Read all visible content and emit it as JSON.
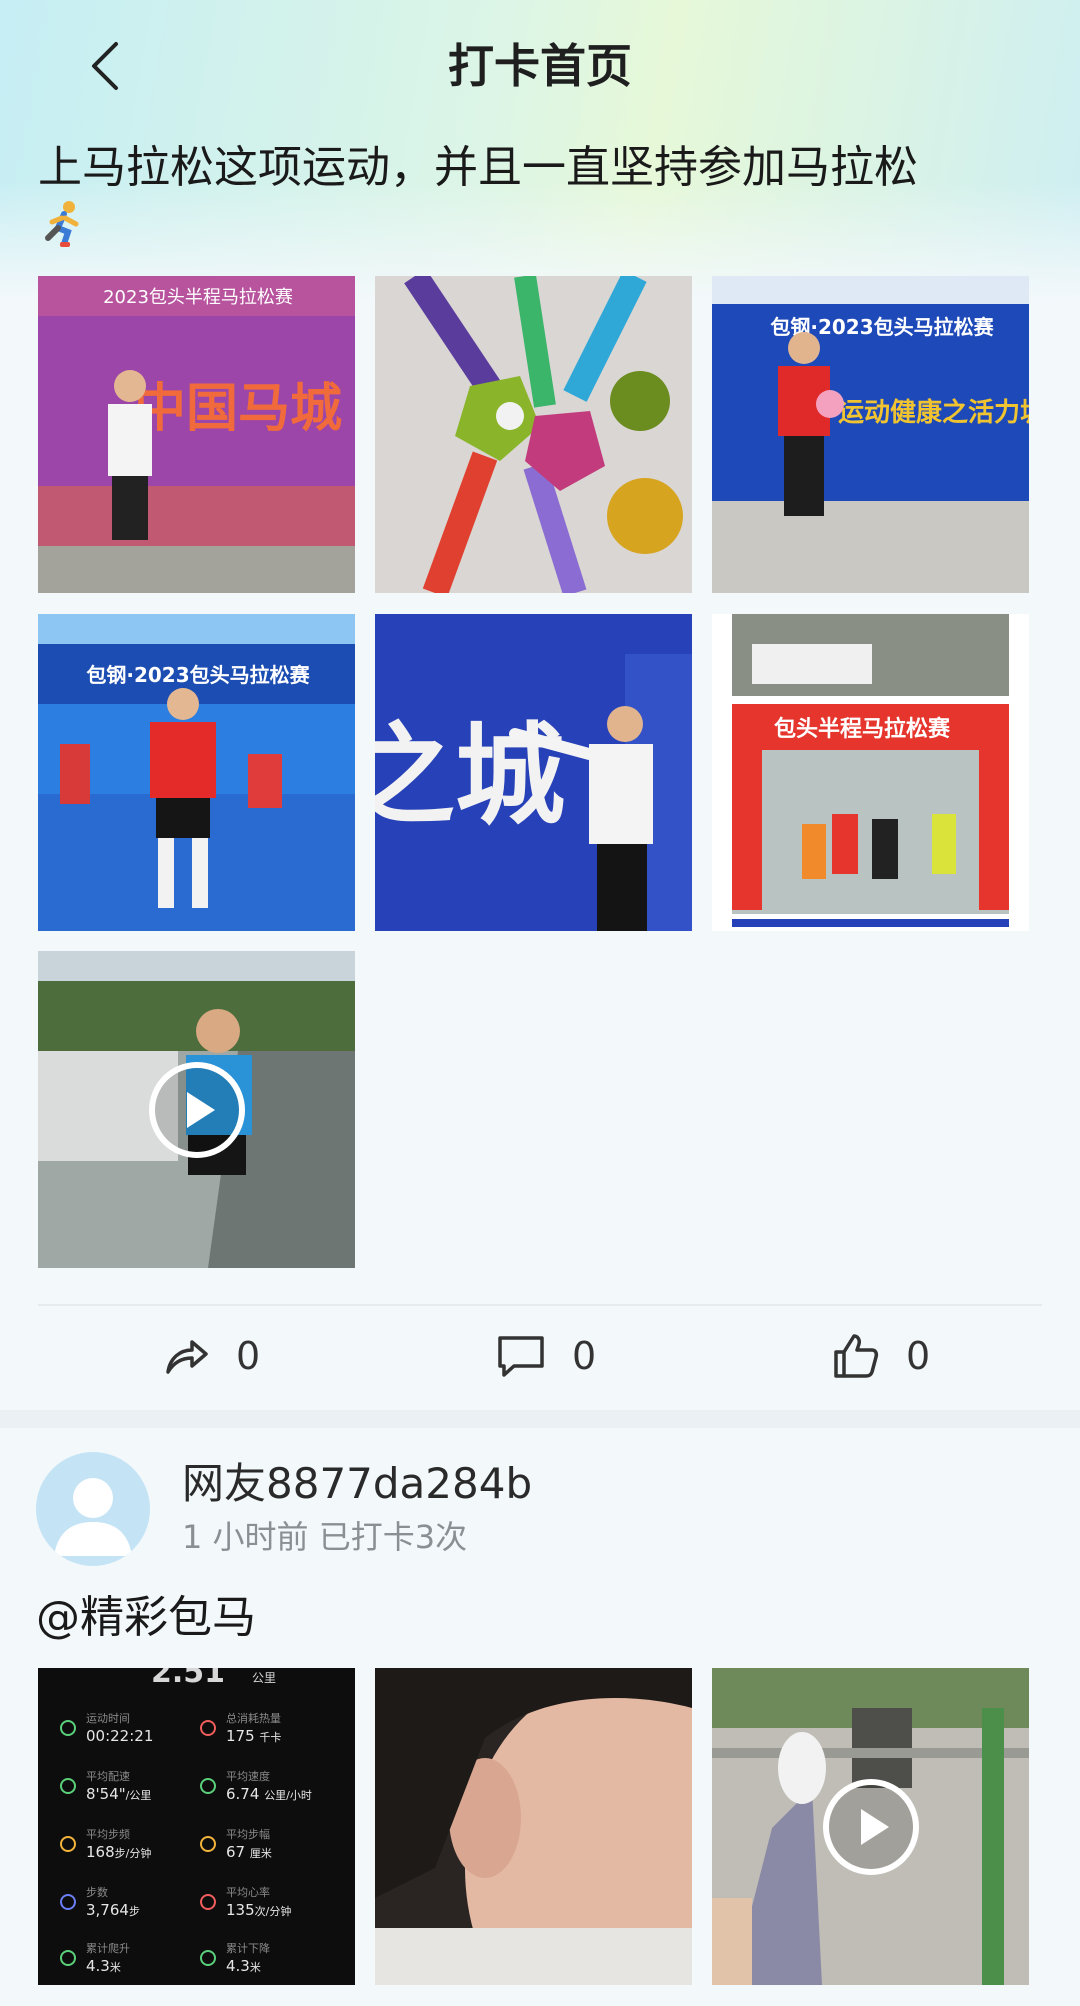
{
  "header": {
    "title": "打卡首页"
  },
  "post1": {
    "text": "上马拉松这项运动，并且一直坚持参加马拉松",
    "emoji_icon": "runner-icon",
    "images": [
      {
        "name": "photo-signature-wall",
        "sign_text": "中国马城",
        "banner_text": "2023包头半程马拉松赛"
      },
      {
        "name": "photo-medals"
      },
      {
        "name": "photo-thumbs-up-banner",
        "banner_text": "包钢·2023包头马拉松赛",
        "slogan": "运动健康之活力城"
      },
      {
        "name": "photo-finish-line",
        "banner_text": "包钢·2023包头马拉松赛"
      },
      {
        "name": "photo-signing-wall",
        "sign_text": "之城"
      },
      {
        "name": "photo-runners-arch",
        "banner_text": "包头半程马拉松赛"
      },
      {
        "name": "video-runner",
        "is_video": true
      }
    ],
    "actions": {
      "share_count": "0",
      "comment_count": "0",
      "like_count": "0"
    }
  },
  "post2": {
    "username": "网友8877da284b",
    "meta": "1 小时前 已打卡3次",
    "text": "@精彩包马",
    "stats_card": {
      "top_value": "2.51",
      "top_unit": "公里",
      "items": [
        {
          "label": "运动时间",
          "value": "00:22:21",
          "unit": ""
        },
        {
          "label": "总消耗热量",
          "value": "175",
          "unit": "千卡"
        },
        {
          "label": "平均配速",
          "value": "8'54\"",
          "unit": "/公里"
        },
        {
          "label": "平均速度",
          "value": "6.74",
          "unit": "公里/小时"
        },
        {
          "label": "平均步频",
          "value": "168",
          "unit": "步/分钟"
        },
        {
          "label": "平均步幅",
          "value": "67",
          "unit": "厘米"
        },
        {
          "label": "步数",
          "value": "3,764",
          "unit": "步"
        },
        {
          "label": "平均心率",
          "value": "135",
          "unit": "次/分钟"
        },
        {
          "label": "累计爬升",
          "value": "4.3",
          "unit": "米"
        },
        {
          "label": "累计下降",
          "value": "4.3",
          "unit": "米"
        }
      ]
    }
  }
}
